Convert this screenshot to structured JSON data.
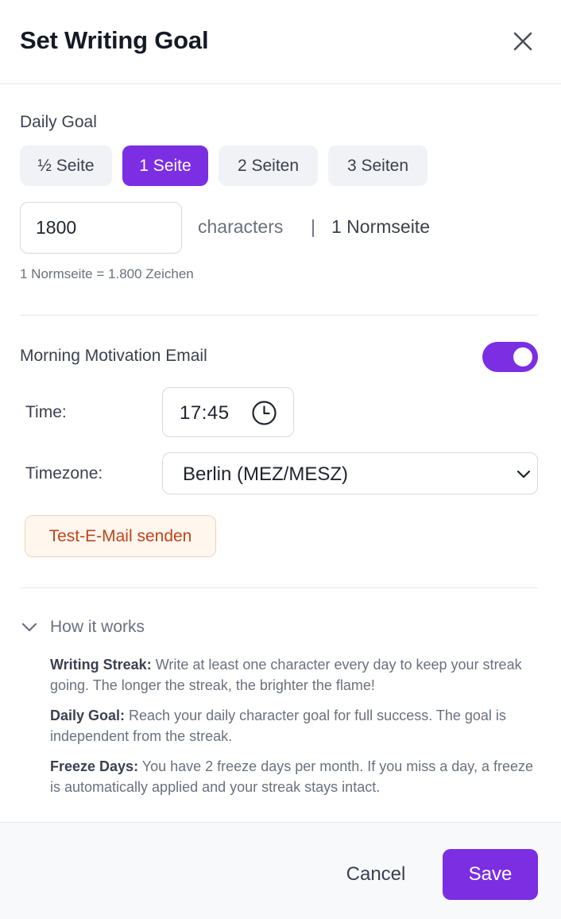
{
  "header": {
    "title": "Set Writing Goal",
    "close_icon": "close-icon"
  },
  "daily_goal": {
    "label": "Daily Goal",
    "presets": [
      {
        "label": "½ Seite",
        "active": false
      },
      {
        "label": "1 Seite",
        "active": true
      },
      {
        "label": "2 Seiten",
        "active": false
      },
      {
        "label": "3 Seiten",
        "active": false
      }
    ],
    "characters_value": "1800",
    "unit_label": "characters",
    "separator": "|",
    "pages_label": "1 Normseite",
    "hint": "1 Normseite = 1.800 Zeichen"
  },
  "morning_email": {
    "label": "Morning Motivation Email",
    "enabled": true,
    "time_label": "Time:",
    "time_value": "17:45",
    "timezone_label": "Timezone:",
    "timezone_value": "Berlin (MEZ/MESZ)",
    "test_button": "Test-E-Mail senden"
  },
  "how_it_works": {
    "title": "How it works",
    "items": [
      {
        "term": "Writing Streak:",
        "text": " Write at least one character every day to keep your streak going. The longer the streak, the brighter the flame!"
      },
      {
        "term": "Daily Goal:",
        "text": " Reach your daily character goal for full success. The goal is independent from the streak."
      },
      {
        "term": "Freeze Days:",
        "text": " You have 2 freeze days per month. If you miss a day, a freeze is automatically applied and your streak stays intact."
      }
    ]
  },
  "footer": {
    "cancel_label": "Cancel",
    "save_label": "Save"
  },
  "colors": {
    "accent": "#7c2ee2",
    "test_button_text": "#c0451a",
    "test_button_bg": "#fff6ee"
  }
}
